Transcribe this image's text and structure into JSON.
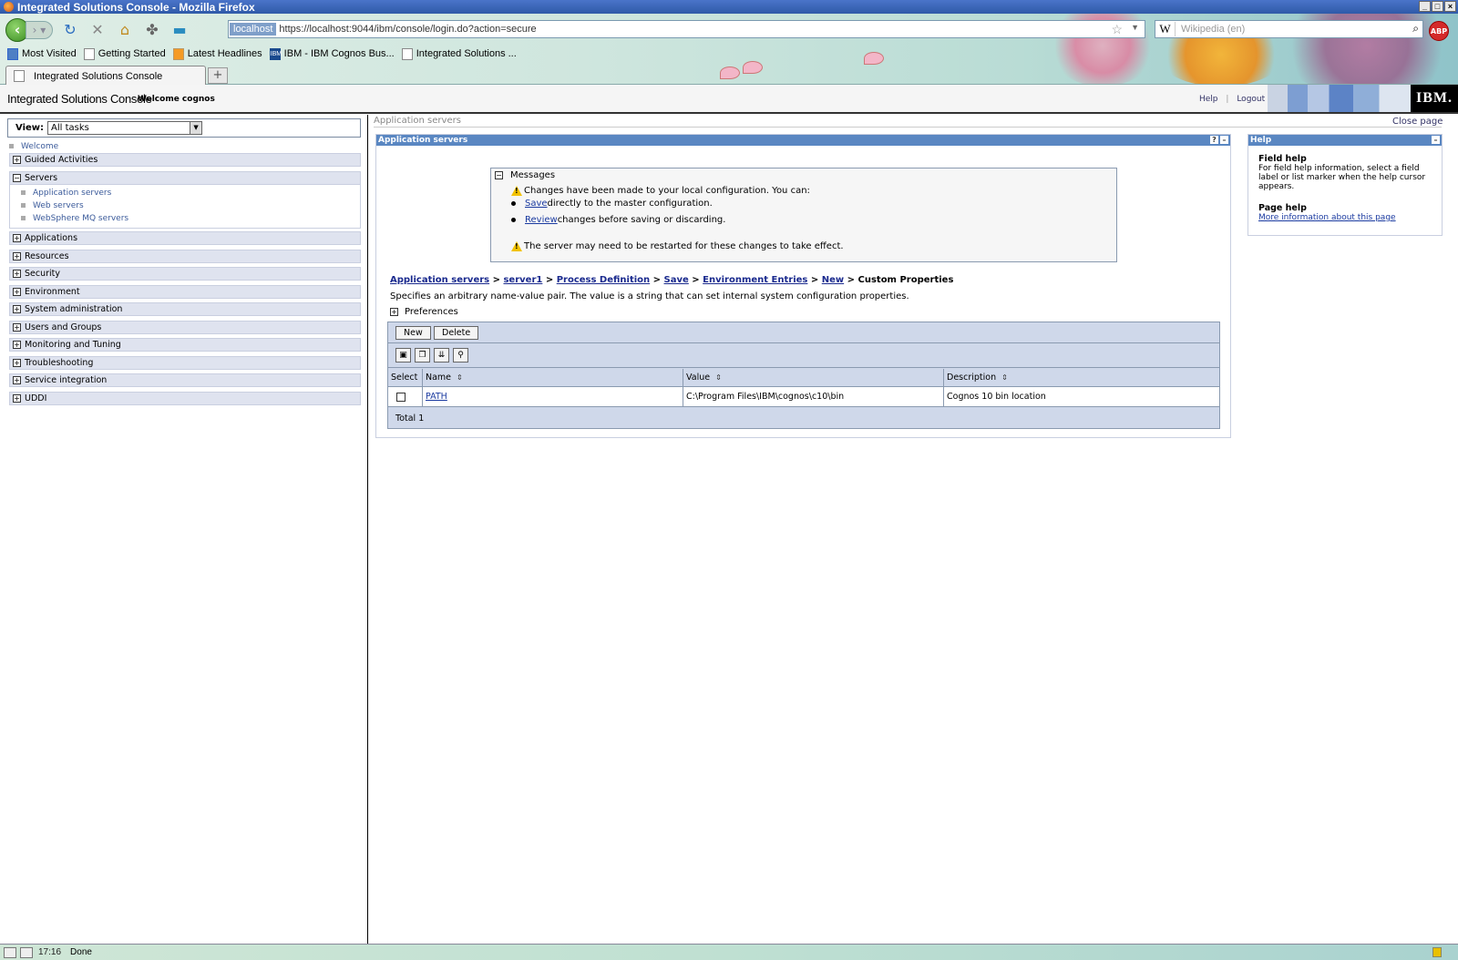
{
  "window": {
    "title": "Integrated Solutions Console - Mozilla Firefox"
  },
  "browser": {
    "url_site": "localhost",
    "url": "https://localhost:9044/ibm/console/login.do?action=secure",
    "search_placeholder": "Wikipedia (en)",
    "search_engine_icon": "W",
    "bookmarks": [
      "Most Visited",
      "Getting Started",
      "Latest Headlines",
      "IBM - IBM Cognos Bus...",
      "Integrated Solutions ..."
    ],
    "tab_title": "Integrated Solutions Console",
    "new_tab": "+",
    "abp": "ABP"
  },
  "console": {
    "title": "Integrated Solutions Console",
    "welcome": "Welcome cognos",
    "help_link": "Help",
    "separator": "|",
    "logout_link": "Logout",
    "logo": "IBM."
  },
  "nav": {
    "view_label": "View:",
    "view_value": "All tasks",
    "welcome": "Welcome",
    "groups": [
      "Guided Activities",
      "Servers",
      "Applications",
      "Resources",
      "Security",
      "Environment",
      "System administration",
      "Users and Groups",
      "Monitoring and Tuning",
      "Troubleshooting",
      "Service integration",
      "UDDI"
    ],
    "servers_items": [
      "Application servers",
      "Web servers",
      "WebSphere MQ servers"
    ]
  },
  "main": {
    "top_crumb": "Application servers",
    "close_page": "Close page",
    "panel_title": "Application servers",
    "messages": {
      "header": "Messages",
      "line1": "Changes have been made to your local configuration. You can:",
      "save_link": "Save",
      "save_text": " directly to the master configuration.",
      "review_link": "Review",
      "review_text": " changes before saving or discarding.",
      "restart": "The server may need to be restarted for these changes to take effect."
    },
    "breadcrumb": {
      "links": [
        "Application servers",
        "server1",
        "Process Definition",
        "Save",
        "Environment Entries",
        "New"
      ],
      "separator": ">",
      "current": "Custom Properties"
    },
    "description": "Specifies an arbitrary name-value pair. The value is a string that can set internal system configuration properties.",
    "preferences": "Preferences",
    "buttons": {
      "new": "New",
      "delete": "Delete"
    },
    "table": {
      "headers": [
        "Select",
        "Name",
        "Value",
        "Description"
      ],
      "rows": [
        {
          "name": "PATH",
          "value": "C:\\Program Files\\IBM\\cognos\\c10\\bin",
          "description": "Cognos 10 bin location"
        }
      ],
      "total": "Total 1"
    }
  },
  "help": {
    "title": "Help",
    "field_help_title": "Field help",
    "field_help_text": "For field help information, select a field label or list marker when the help cursor appears.",
    "page_help_title": "Page help",
    "page_help_link": "More information about this page"
  },
  "status": {
    "text": "Done",
    "time": "17:16"
  }
}
